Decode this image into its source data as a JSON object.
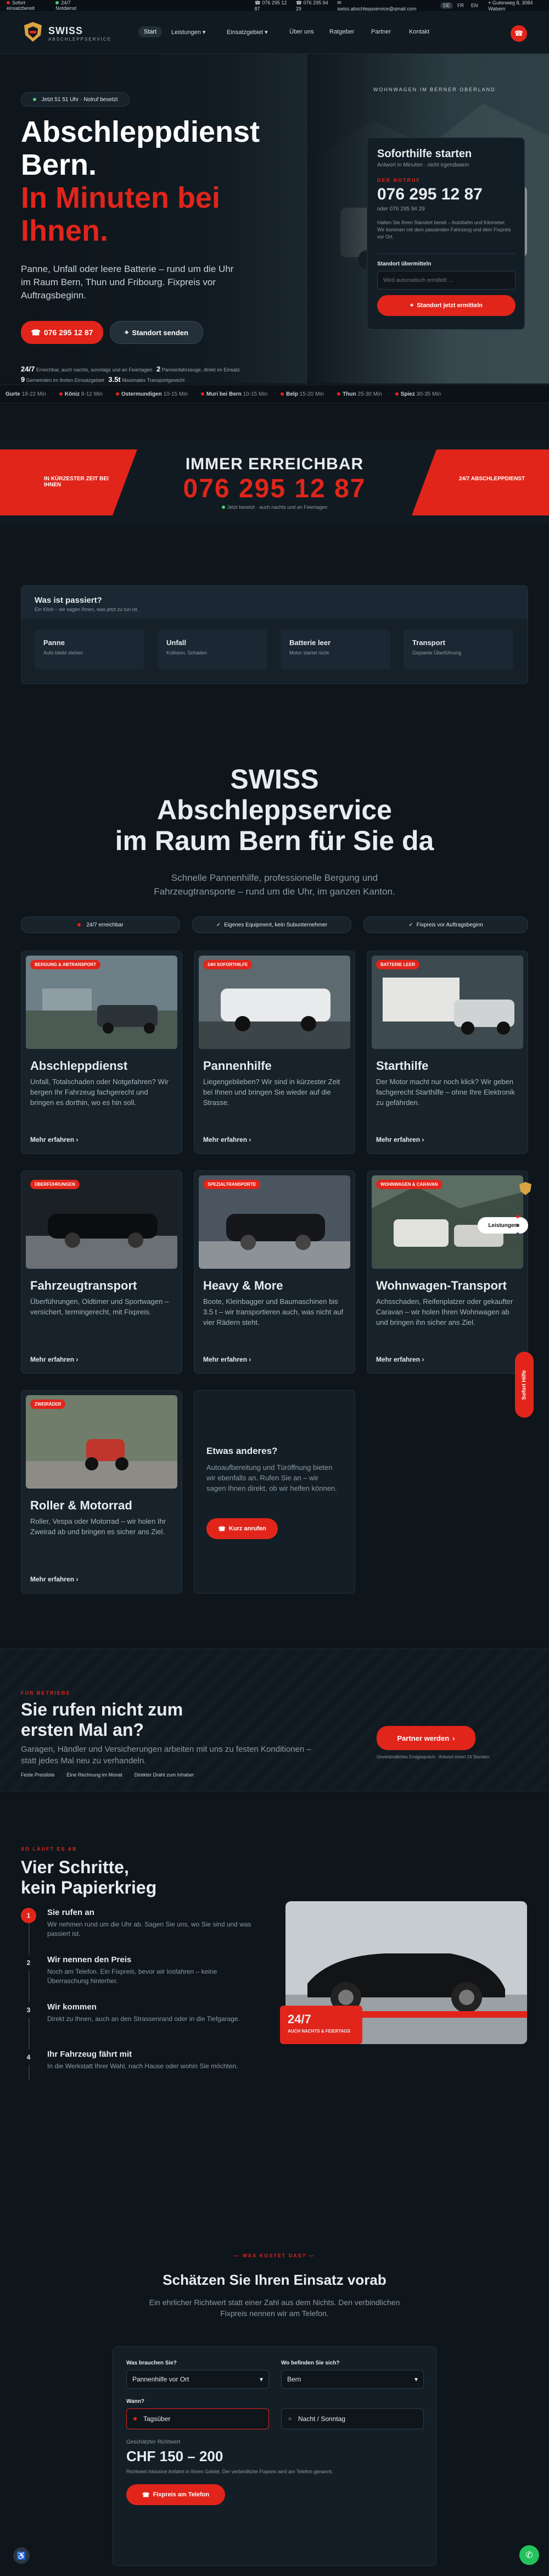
{
  "topbar": {
    "left1": "Sofort einsatzbereit",
    "left2": "24/7 Notdienst",
    "phone1": "076 295 12 87",
    "phone2": "076 295 94 29",
    "email": "swiss.abschleppservice@gmail.com",
    "lang": [
      "DE",
      "FR",
      "EN"
    ],
    "address": "Gutenweg 8, 3084 Wabern"
  },
  "nav": {
    "brand": "SWISS",
    "brand_sub": "ABSCHLEPPSERVICE",
    "items": [
      "Start",
      "Leistungen",
      "Einsatzgebiet",
      "Über uns",
      "Ratgeber",
      "Partner",
      "Kontakt"
    ]
  },
  "hero": {
    "badge": "Jetzt 51 51 Uhr · Notruf besetzt",
    "title1": "Abschleppdienst",
    "title2": "Bern.",
    "title3": "In Minuten bei",
    "title4": "Ihnen.",
    "lead": "Panne, Unfall oder leere Batterie – rund um die Uhr im Raum Bern, Thun und Fribourg. Fixpreis vor Auftragsbeginn.",
    "cta_phone": "076 295 12 87",
    "cta_location": "Standort senden",
    "stats": [
      {
        "k": "24/7",
        "v": "Erreichbar, auch nachts, sonntags und an Feiertagen"
      },
      {
        "k": "2",
        "v": "Pannenfahrzeuge, direkt im Einsatz"
      },
      {
        "k": "9",
        "v": "Gemeinden im festen Einsatzgebiet"
      },
      {
        "k": "3.5t",
        "v": "Maximales Transportgewicht"
      }
    ],
    "photo_caption": "WOHNWAGEN IM BERNER OBERLAND"
  },
  "sofort": {
    "title": "Soforthilfe starten",
    "sub": "Antwort in Minuten · nicht irgendwann",
    "label": "DER NOTRUF",
    "phone": "076 295 12 87",
    "phone_sub": "oder 076 295 94 29",
    "note": "Halten Sie Ihren Standort bereit – Autobahn und Kilometer. Wir kommen mit dem passenden Fahrzeug und dem Fixpreis vor Ort.",
    "loc_label": "Standort übermitteln",
    "loc_placeholder": "Wird automatisch ermittelt …",
    "loc_button": "Standort jetzt ermitteln"
  },
  "ticker": [
    {
      "c": "Gurte",
      "t": "18-22 Min"
    },
    {
      "c": "Köniz",
      "t": "8-12 Min"
    },
    {
      "c": "Ostermundigen",
      "t": "10-15 Min"
    },
    {
      "c": "Muri bei Bern",
      "t": "10-15 Min"
    },
    {
      "c": "Belp",
      "t": "15-20 Min"
    },
    {
      "c": "Thun",
      "t": "25-30 Min"
    },
    {
      "c": "Spiez",
      "t": "30-35 Min"
    }
  ],
  "band": {
    "left": "IN KÜRZESTER ZEIT BEI IHNEN",
    "title": "IMMER ERREICHBAR",
    "phone": "076 295 12 87",
    "sub": "Jetzt besetzt · auch nachts und an Feiertagen",
    "right": "24/7 ABSCHLEPPDIENST"
  },
  "issue": {
    "title": "Was ist passiert?",
    "sub": "Ein Klick – wir sagen Ihnen, was jetzt zu tun ist.",
    "options": [
      {
        "t": "Panne",
        "s": "Auto bleibt stehen"
      },
      {
        "t": "Unfall",
        "s": "Kollision, Schaden"
      },
      {
        "t": "Batterie leer",
        "s": "Motor startet nicht"
      },
      {
        "t": "Transport",
        "s": "Geplante Überführung"
      }
    ]
  },
  "services": {
    "h1": "SWISS",
    "h2": "Abschleppservice",
    "h3": "im Raum Bern für Sie da",
    "lead": "Schnelle Pannenhilfe, professionelle Bergung und Fahrzeugtransporte – rund um die Uhr, im ganzen Kanton.",
    "chips": [
      "24/7 erreichbar",
      "Eigenes Equipment, kein Subunternehmer",
      "Fixpreis vor Auftragsbeginn"
    ],
    "more": "Mehr erfahren",
    "cards": [
      {
        "badge": "BERGUNG & ABTRANSPORT",
        "title": "Abschleppdienst",
        "text": "Unfall, Totalschaden oder Notgefahren? Wir bergen Ihr Fahrzeug fachgerecht und bringen es dorthin, wo es hin soll."
      },
      {
        "badge": "24H SOFORTHILFE",
        "title": "Pannenhilfe",
        "text": "Liegengeblieben? Wir sind in kürzester Zeit bei Ihnen und bringen Sie wieder auf die Strasse."
      },
      {
        "badge": "BATTERIE LEER",
        "title": "Starthilfe",
        "text": "Der Motor macht nur noch klick? Wir geben fachgerecht Starthilfe – ohne Ihre Elektronik zu gefährden."
      },
      {
        "badge": "ÜBERFÜHRUNGEN",
        "title": "Fahrzeugtransport",
        "text": "Überführungen, Oldtimer und Sportwagen – versichert, termingerecht, mit Fixpreis."
      },
      {
        "badge": "SPEZIALTRANSPORTE",
        "title": "Heavy & More",
        "text": "Boote, Kleinbagger und Baumaschinen bis 3.5 t – wir transportieren auch, was nicht auf vier Rädern steht."
      },
      {
        "badge": "WOHNWAGEN & CARAVAN",
        "title": "Wohnwagen-Transport",
        "text": "Achsschaden, Reifenplatzer oder gekaufter Caravan – wir holen Ihren Wohnwagen ab und bringen ihn sicher ans Ziel."
      },
      {
        "badge": "ZWEIRÄDER",
        "title": "Roller & Motorrad",
        "text": "Roller, Vespa oder Motorrad – wir holen Ihr Zweirad ab und bringen es sicher ans Ziel."
      }
    ],
    "other_title": "Etwas anderes?",
    "other_text": "Autoaufbereitung und Türöffnung bieten wir ebenfalls an. Rufen Sie an – wir sagen Ihnen direkt, ob wir helfen können.",
    "other_button": "Kurz anrufen",
    "lektion": "Leistungen"
  },
  "partner": {
    "kicker": "FÜR BETRIEBE",
    "title1": "Sie rufen nicht zum",
    "title2": "ersten Mal an?",
    "text": "Garagen, Händler und Versicherungen arbeiten mit uns zu festen Konditionen – statt jedes Mal neu zu verhandeln.",
    "chips": [
      "Feste Preisliste",
      "Eine Rechnung im Monat",
      "Direkter Draht zum Inhaber"
    ],
    "button": "Partner werden",
    "note": "Unverbindliches Erstgespräch · Antwort innert 24 Stunden"
  },
  "steps": {
    "kicker": "SO LÄUFT ES AB",
    "title1": "Vier Schritte,",
    "title2": "kein Papierkrieg",
    "items": [
      {
        "n": "1",
        "t": "Sie rufen an",
        "s": "Wir nehmen rund um die Uhr ab. Sagen Sie uns, wo Sie sind und was passiert ist."
      },
      {
        "n": "2",
        "t": "Wir nennen den Preis",
        "s": "Noch am Telefon. Ein Fixpreis, bevor wir losfahren – keine Überraschung hinterher."
      },
      {
        "n": "3",
        "t": "Wir kommen",
        "s": "Direkt zu Ihnen, auch an den Strassenrand oder in die Tiefgarage."
      },
      {
        "n": "4",
        "t": "Ihr Fahrzeug fährt mit",
        "s": "In die Werkstatt Ihrer Wahl, nach Hause oder wohin Sie möchten."
      }
    ],
    "photo_big": "24/7",
    "photo_small": "AUCH NACHTS & FEIERTAGS"
  },
  "estimate": {
    "kicker": "WAS KOSTET DAS?",
    "title": "Schätzen Sie Ihren Einsatz vorab",
    "text": "Ein ehrlicher Richtwert statt einer Zahl aus dem Nichts. Den verbindlichen Fixpreis nennen wir am Telefon.",
    "q1": "Was brauchen Sie?",
    "q1_value": "Pannenhilfe vor Ort",
    "q2": "Wo befinden Sie sich?",
    "q2_value": "Bern",
    "q3": "Wann?",
    "opt1": "Tagsüber",
    "opt2": "Nacht / Sonntag",
    "result_label": "Geschätzter Richtwert",
    "result": "CHF 150 – 200",
    "result_note": "Richtwert inklusive Anfahrt in Ihrem Gebiet. Der verbindliche Fixpreis wird am Telefon genannt.",
    "button": "Fixpreis am Telefon"
  },
  "side": {
    "label": "Sofort Hilfe"
  }
}
